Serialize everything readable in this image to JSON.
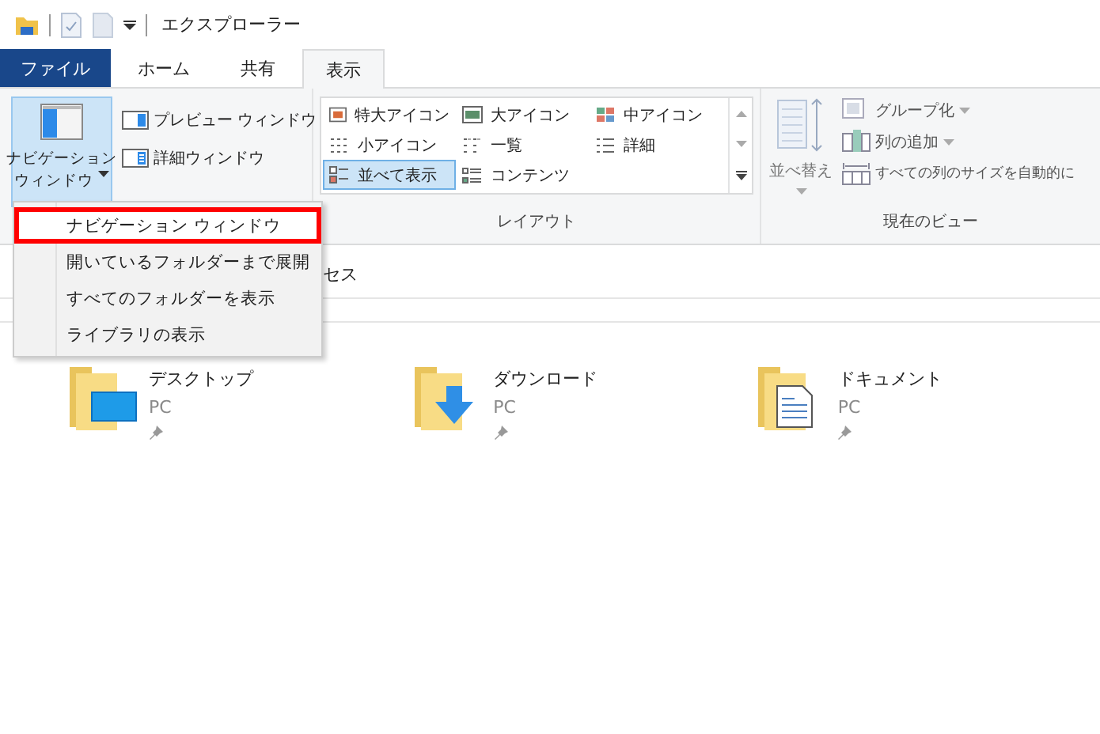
{
  "title_bar": {
    "title": "エクスプローラー"
  },
  "tabs": [
    {
      "label": "ファイル",
      "kind": "file",
      "selected": false
    },
    {
      "label": "ホーム",
      "kind": "tab",
      "selected": false
    },
    {
      "label": "共有",
      "kind": "tab",
      "selected": false
    },
    {
      "label": "表示",
      "kind": "tab",
      "selected": true
    }
  ],
  "ribbon": {
    "panes": {
      "navigation_pane": {
        "lines": [
          "ナビゲーション",
          "ウィンドウ"
        ],
        "pressed": true
      },
      "buttons": [
        {
          "label": "プレビュー ウィンドウ",
          "kind": "preview"
        },
        {
          "label": "詳細ウィンドウ",
          "kind": "details"
        }
      ]
    },
    "layout": {
      "label": "レイアウト",
      "options": [
        {
          "label": "特大アイコン",
          "kind": "extra-large",
          "selected": false
        },
        {
          "label": "大アイコン",
          "kind": "large",
          "selected": false
        },
        {
          "label": "中アイコン",
          "kind": "medium",
          "selected": false
        },
        {
          "label": "小アイコン",
          "kind": "small",
          "selected": false
        },
        {
          "label": "一覧",
          "kind": "list",
          "selected": false
        },
        {
          "label": "詳細",
          "kind": "details",
          "selected": false
        },
        {
          "label": "並べて表示",
          "kind": "tiles",
          "selected": true
        },
        {
          "label": "コンテンツ",
          "kind": "content",
          "selected": false
        }
      ]
    },
    "current_view": {
      "label": "現在のビュー",
      "sort": {
        "label": "並べ替え"
      },
      "commands": [
        {
          "label": "グループ化",
          "kind": "group",
          "dropdown": true
        },
        {
          "label": "列の追加",
          "kind": "add-columns",
          "dropdown": true
        },
        {
          "label": "すべての列のサイズを自動的に",
          "kind": "fit-columns",
          "dropdown": false
        }
      ]
    }
  },
  "address_bar": {
    "text": "セス"
  },
  "nav_menu": {
    "items": [
      {
        "label": "ナビゲーション ウィンドウ",
        "highlighted": true
      },
      {
        "label": "開いているフォルダーまで展開",
        "highlighted": false
      },
      {
        "label": "すべてのフォルダーを表示",
        "highlighted": false
      },
      {
        "label": "ライブラリの表示",
        "highlighted": false
      }
    ]
  },
  "folders": [
    {
      "name": "デスクトップ",
      "location": "PC",
      "kind": "desktop"
    },
    {
      "name": "ダウンロード",
      "location": "PC",
      "kind": "downloads"
    },
    {
      "name": "ドキュメント",
      "location": "PC",
      "kind": "documents"
    }
  ]
}
